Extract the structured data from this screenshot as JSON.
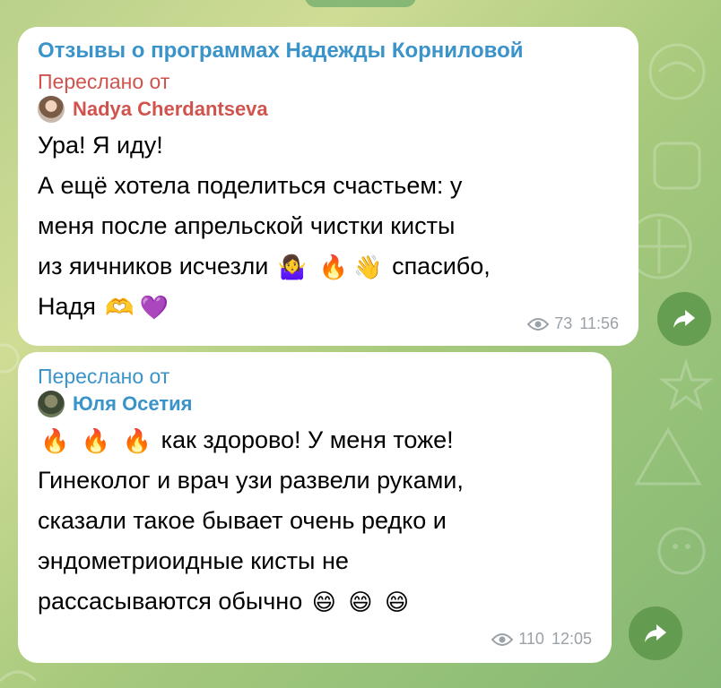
{
  "colors": {
    "channel_title": "#3a93c9",
    "forward_red": "#d0534e",
    "forward_blue": "#3a93c9",
    "meta_gray": "#9aa1a7",
    "bubble_bg": "#ffffff",
    "share_button": "#5c964a"
  },
  "messages": [
    {
      "channel_title": "Отзывы о программах Надежды Корниловой",
      "forwarded_label": "Переслано от",
      "forwarded_from": "Nadya Cherdantseva",
      "lines": [
        "Ура! Я иду!",
        "А ещё хотела поделиться счастьем: у",
        "меня после апрельской чистки кисты",
        "из яичников исчезли",
        "спасибо,",
        "Надя"
      ],
      "emojis": {
        "shrug": "🤷‍♀️",
        "fire": "🔥",
        "wave": "👋",
        "heart_hands": "🫶",
        "purple_heart": "💜"
      },
      "views": "73",
      "time": "11:56"
    },
    {
      "forwarded_label": "Переслано от",
      "forwarded_from": "Юля Осетия",
      "lines": [
        "как здорово! У меня тоже!",
        "Гинеколог и врач узи развели руками,",
        "сказали такое бывает очень редко и",
        "эндометриоидные кисты не",
        "рассасываются обычно"
      ],
      "emojis": {
        "fire": "🔥",
        "grin": "😄"
      },
      "views": "110",
      "time": "12:05"
    }
  ],
  "icons": {
    "views": "eye-icon",
    "share": "share-arrow-icon"
  }
}
